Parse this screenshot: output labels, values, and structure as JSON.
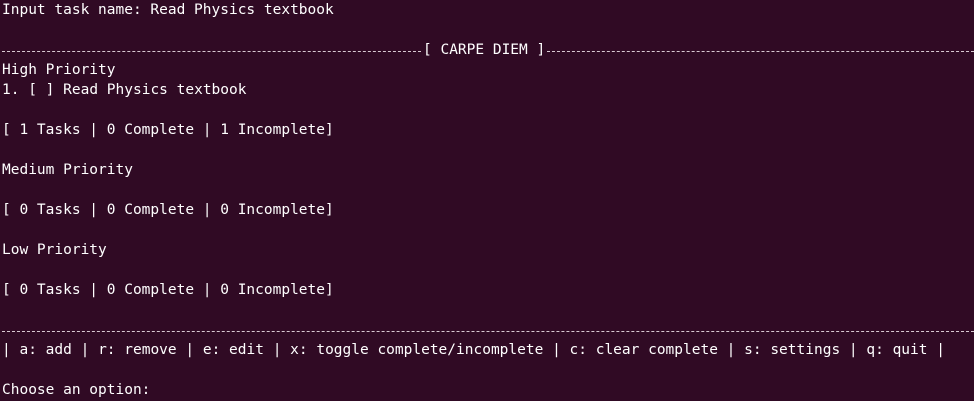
{
  "prompt_line": {
    "label": "Input task name: ",
    "value": "Read Physics textbook"
  },
  "banner": {
    "title": "[ CARPE DIEM ]"
  },
  "sections": [
    {
      "heading": "High Priority",
      "tasks": [
        {
          "number": "1.",
          "checkbox": "[ ]",
          "name": "Read Physics textbook"
        }
      ],
      "summary": "[ 1 Tasks | 0 Complete | 1 Incomplete]"
    },
    {
      "heading": "Medium Priority",
      "tasks": [],
      "summary": "[ 0 Tasks | 0 Complete | 0 Incomplete]"
    },
    {
      "heading": "Low Priority",
      "tasks": [],
      "summary": "[ 0 Tasks | 0 Complete | 0 Incomplete]"
    }
  ],
  "menu": {
    "separator": "|",
    "items": [
      "a: add",
      "r: remove",
      "e: edit",
      "x: toggle complete/incomplete",
      "c: clear complete",
      "s: settings",
      "q: quit"
    ]
  },
  "choose_prompt": {
    "label": "Choose an option: "
  },
  "colors": {
    "background": "#300a24",
    "foreground": "#ffffff"
  }
}
